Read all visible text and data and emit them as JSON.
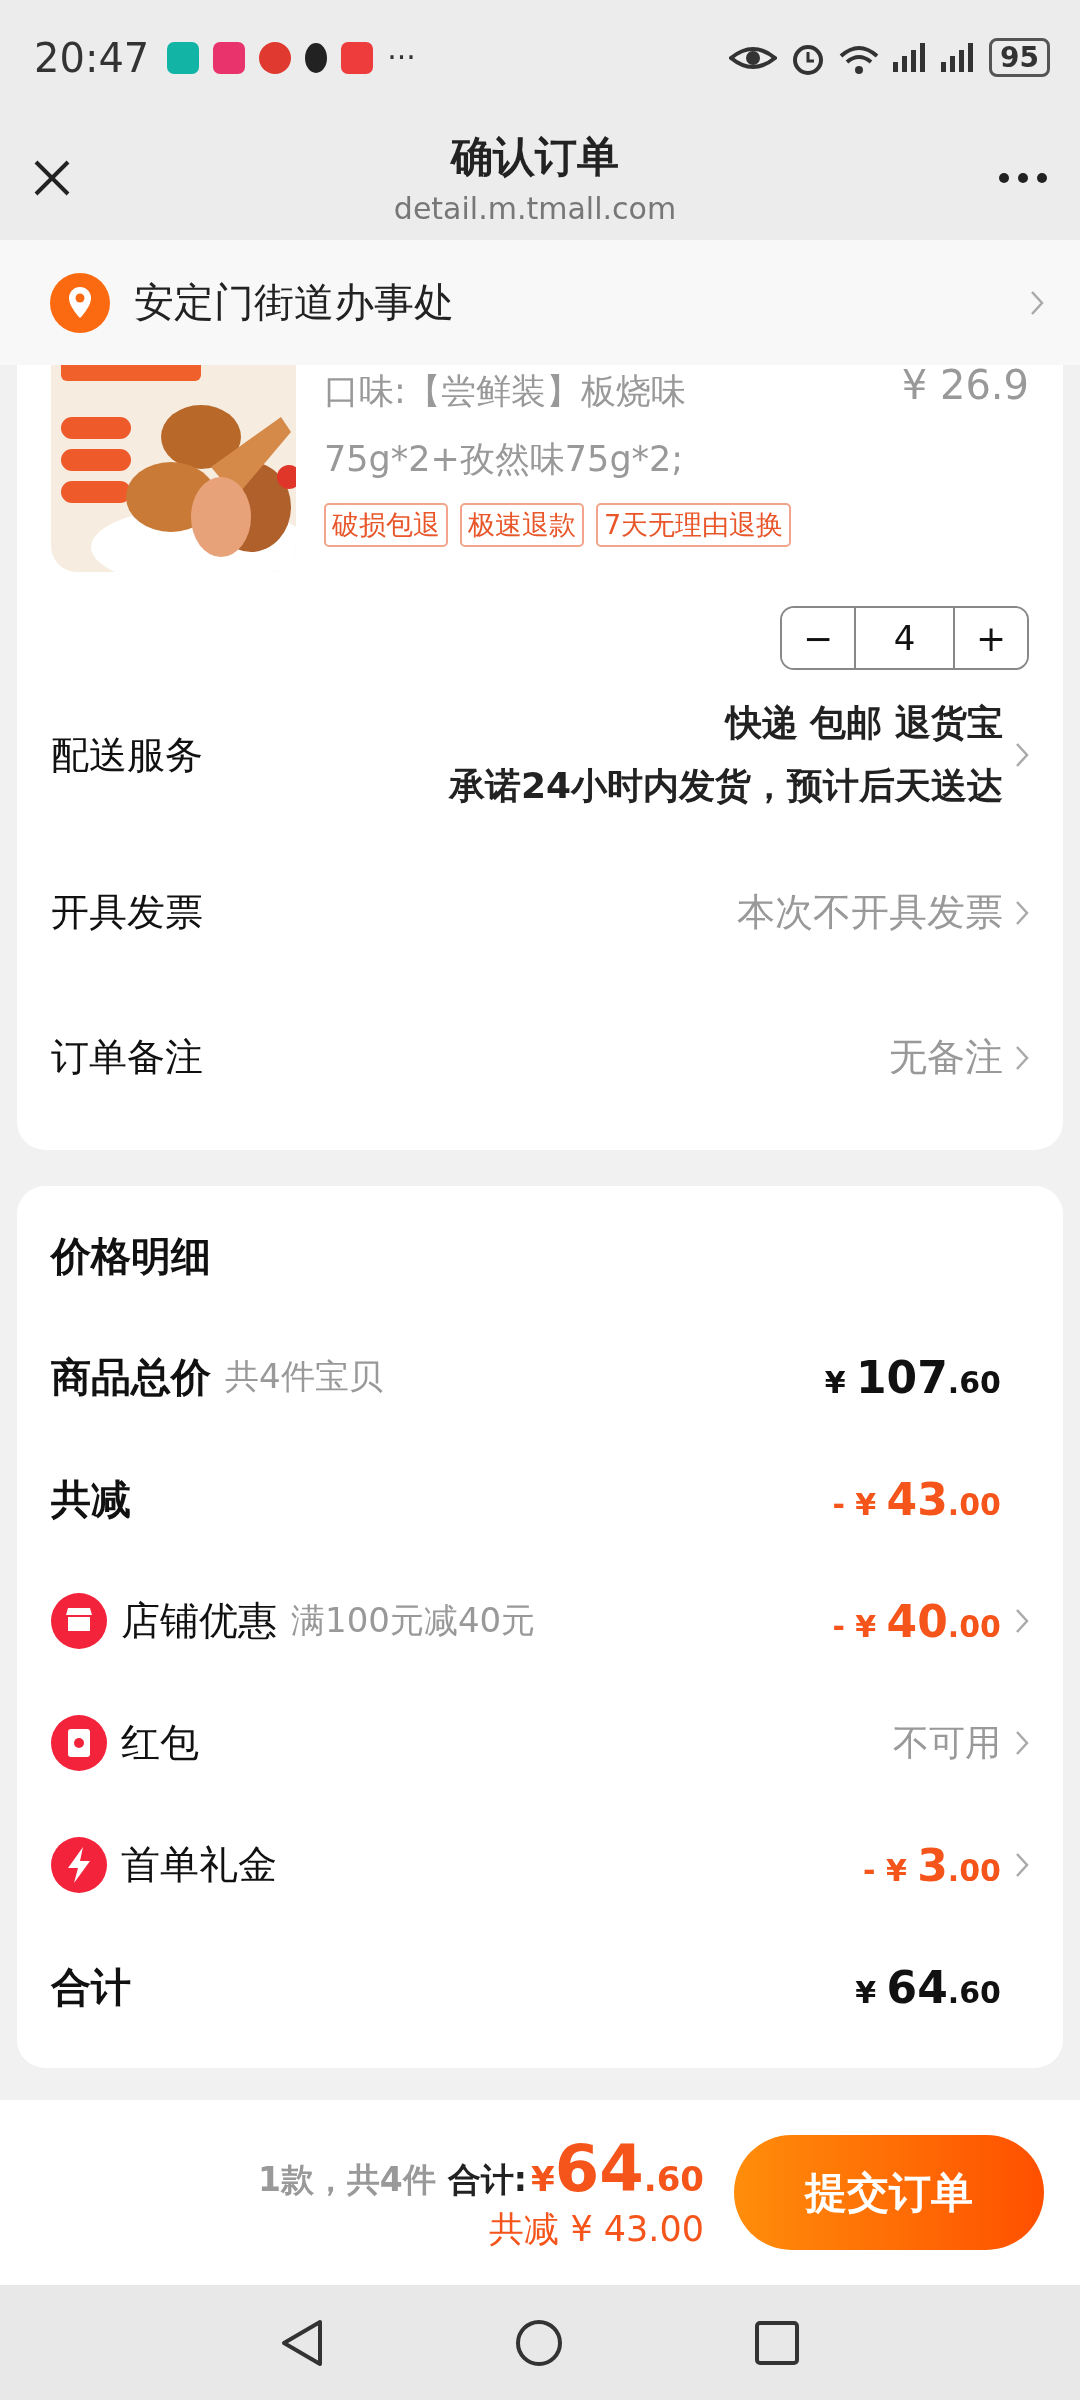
{
  "status_bar": {
    "time": "20:47",
    "more": "···",
    "battery": "95"
  },
  "header": {
    "title": "确认订单",
    "url": "detail.m.tmall.com"
  },
  "address": {
    "text": "安定门街道办事处"
  },
  "product": {
    "spec": "口味:【尝鲜装】板烧味75g*2+孜然味75g*2;",
    "price": "¥ 26.9",
    "tags": [
      "破损包退",
      "极速退款",
      "7天无理由退换"
    ],
    "quantity": {
      "minus": "−",
      "value": "4",
      "plus": "+"
    }
  },
  "order_rows": [
    {
      "kind": "delivery",
      "label": "配送服务",
      "lines": [
        "快递 包邮 退货宝",
        "承诺24小时内发货，预计后天送达"
      ]
    },
    {
      "kind": "plain",
      "label": "开具发票",
      "value": "本次不开具发票"
    },
    {
      "kind": "plain",
      "label": "订单备注",
      "value": "无备注"
    }
  ],
  "price_detail": {
    "title": "价格明细",
    "rows": [
      {
        "kind": "total",
        "label": "商品总价",
        "note": "共4件宝贝",
        "amount": {
          "prefix": "¥ ",
          "main": "107",
          "fraction": ".60"
        },
        "discount": false,
        "arrow": false
      },
      {
        "kind": "total",
        "label": "共减",
        "amount": {
          "prefix": "- ¥ ",
          "main": "43",
          "fraction": ".00"
        },
        "discount": true,
        "arrow": false
      },
      {
        "kind": "shop",
        "label": "店铺优惠",
        "note": "满100元减40元",
        "amount": {
          "prefix": "- ¥ ",
          "main": "40",
          "fraction": ".00"
        },
        "discount": true,
        "arrow": true
      },
      {
        "kind": "packet",
        "label": "红包",
        "value": "不可用",
        "arrow": true
      },
      {
        "kind": "bolt",
        "label": "首单礼金",
        "amount": {
          "prefix": "- ¥ ",
          "main": "3",
          "fraction": ".00"
        },
        "discount": true,
        "arrow": true
      },
      {
        "kind": "total",
        "label": "合计",
        "amount": {
          "prefix": "¥ ",
          "main": "64",
          "fraction": ".60"
        },
        "discount": false,
        "arrow": false
      }
    ]
  },
  "checkout_bar": {
    "count": "1款，共4件",
    "total_label": "合计:",
    "currency": "¥",
    "main": "64",
    "fraction": ".60",
    "saved": "共减 ¥ 43.00",
    "submit": "提交订单"
  }
}
